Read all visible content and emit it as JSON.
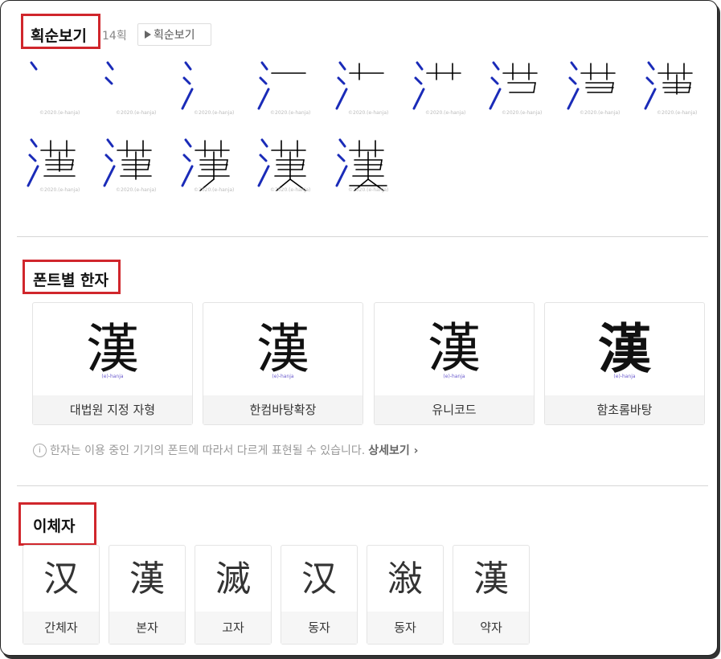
{
  "stroke_section": {
    "title": "획순보기",
    "count": "14획",
    "play_label": "획순보기",
    "copyright": "©2020.(e-hanja)"
  },
  "font_section": {
    "title": "폰트별 한자",
    "glyph": "漢",
    "credit": "(e)-hanja",
    "cards": [
      {
        "label": "대법원 지정 자형"
      },
      {
        "label": "한컴바탕확장"
      },
      {
        "label": "유니코드"
      },
      {
        "label": "함초롬바탕"
      }
    ],
    "notice": "한자는 이용 중인 기기의 폰트에 따라서 다르게 표현될 수 있습니다.",
    "more_label": "상세보기"
  },
  "variant_section": {
    "title": "이체자",
    "cards": [
      {
        "glyph": "汉",
        "label": "간체자"
      },
      {
        "glyph": "漢",
        "label": "본자"
      },
      {
        "glyph": "滅",
        "label": "고자"
      },
      {
        "glyph": "汉",
        "label": "동자"
      },
      {
        "glyph": "潊",
        "label": "동자"
      },
      {
        "glyph": "漢",
        "label": "약자"
      }
    ]
  },
  "colors": {
    "highlight_box": "#d0262c",
    "stroke_new": "#1a2bb8",
    "stroke_old": "#000000"
  }
}
